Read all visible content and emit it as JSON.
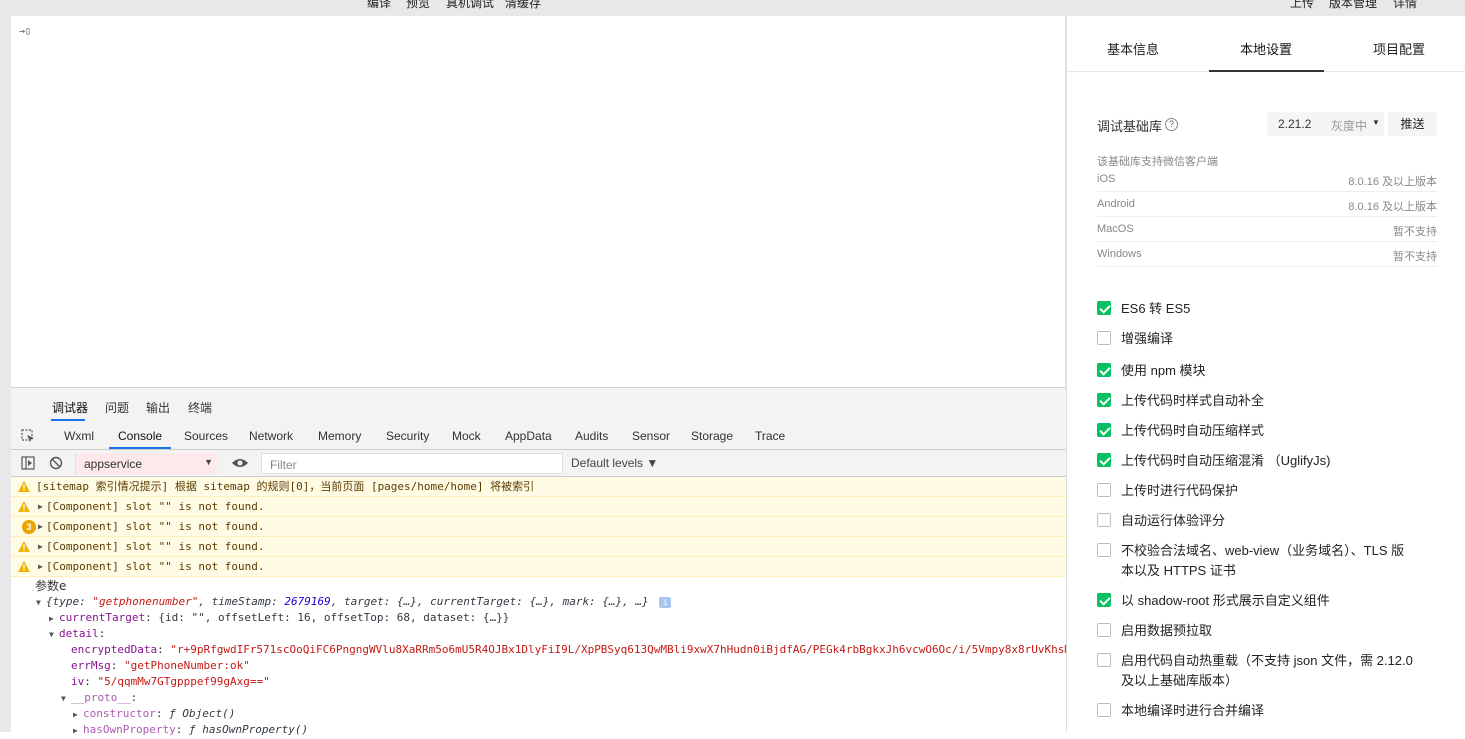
{
  "topbar": {
    "left_items": [
      "编译",
      "预览",
      "真机调试",
      "清缓存"
    ],
    "right_items": [
      "上传",
      "版本管理",
      "详情"
    ]
  },
  "simulator": {
    "cursor_text": "→▯"
  },
  "devtools": {
    "tabs": [
      "调试器",
      "问题",
      "输出",
      "终端"
    ],
    "panel_tabs": [
      "Wxml",
      "Console",
      "Sources",
      "Network",
      "Memory",
      "Security",
      "Mock",
      "AppData",
      "Audits",
      "Sensor",
      "Storage",
      "Trace"
    ],
    "active_panel": "Console",
    "context": "appservice",
    "filter_placeholder": "Filter",
    "levels": "Default levels ▼",
    "logs": {
      "sitemap": "[sitemap 索引情况提示] 根据 sitemap 的规则[0]，当前页面 [pages/home/home] 将被索引",
      "warn_badge": "3",
      "slot_msg": "[Component] slot \"\" is not found.",
      "param_label": "参数e",
      "obj_summary_1": "{type: ",
      "obj_type": "\"getphonenumber\"",
      "obj_summary_2": ", timeStamp: ",
      "obj_timestamp": "2679169",
      "obj_summary_3": ", target: {…}, currentTarget: {…}, mark: {…}, …}",
      "info_icon": "i",
      "currentTarget_key": "currentTarget",
      "currentTarget_val": ": {id: \"\", offsetLeft: 16, offsetTop: 68, dataset: {…}}",
      "detail_key": "detail",
      "encrypted_key": "encryptedData",
      "encrypted_val": "\"r+9pRfgwdIFr571scOoQiFC6PngngWVlu8XaRRm5o6mU5R4OJBx1DlyFiI9L/XpPBSyq613QwMBli9xwX7hHudn0iBjdfAG/PEGk4rbBgkxJh6vcwO6Oc/i/5Vmpy8x8rUvKhsM",
      "errmsg_key": "errMsg",
      "errmsg_val": "\"getPhoneNumber:ok\"",
      "iv_key": "iv",
      "iv_val": "\"5/qqmMw7GTgpppef99gAxg==\"",
      "proto_key": "__proto__",
      "constructor_key": "constructor",
      "constructor_val": "ƒ Object()",
      "hasown_key": "hasOwnProperty",
      "hasown_val": "ƒ hasOwnProperty()"
    }
  },
  "settings": {
    "tabs": [
      "基本信息",
      "本地设置",
      "项目配置"
    ],
    "active_tab": "本地设置",
    "debug_lib_label": "调试基础库",
    "help_icon": "?",
    "version": "2.21.2",
    "gray": "灰度中",
    "push_button": "推送",
    "support_note": "该基础库支持微信客户端",
    "platforms": [
      {
        "name": "iOS",
        "value": "8.0.16 及以上版本"
      },
      {
        "name": "Android",
        "value": "8.0.16 及以上版本"
      },
      {
        "name": "MacOS",
        "value": "暂不支持"
      },
      {
        "name": "Windows",
        "value": "暂不支持"
      }
    ],
    "options": [
      {
        "label": "ES6 转 ES5",
        "checked": true
      },
      {
        "label": "增强编译",
        "checked": false
      },
      {
        "label": "使用 npm 模块",
        "checked": true
      },
      {
        "label": "上传代码时样式自动补全",
        "checked": true
      },
      {
        "label": "上传代码时自动压缩样式",
        "checked": true
      },
      {
        "label": "上传代码时自动压缩混淆 （UglifyJs)",
        "checked": true
      },
      {
        "label": "上传时进行代码保护",
        "checked": false
      },
      {
        "label": "自动运行体验评分",
        "checked": false
      },
      {
        "label": "不校验合法域名、web-view（业务域名）、TLS 版本以及 HTTPS 证书",
        "checked": false
      },
      {
        "label": "以 shadow-root 形式展示自定义组件",
        "checked": true
      },
      {
        "label": "启用数据预拉取",
        "checked": false
      },
      {
        "label": "启用代码自动热重载（不支持 json 文件，需 2.12.0 及以上基础库版本）",
        "checked": false
      },
      {
        "label": "本地编译时进行合并编译",
        "checked": false
      }
    ],
    "colors": {
      "check_on": "#07c160",
      "warn_bg": "#fffbe5"
    }
  }
}
